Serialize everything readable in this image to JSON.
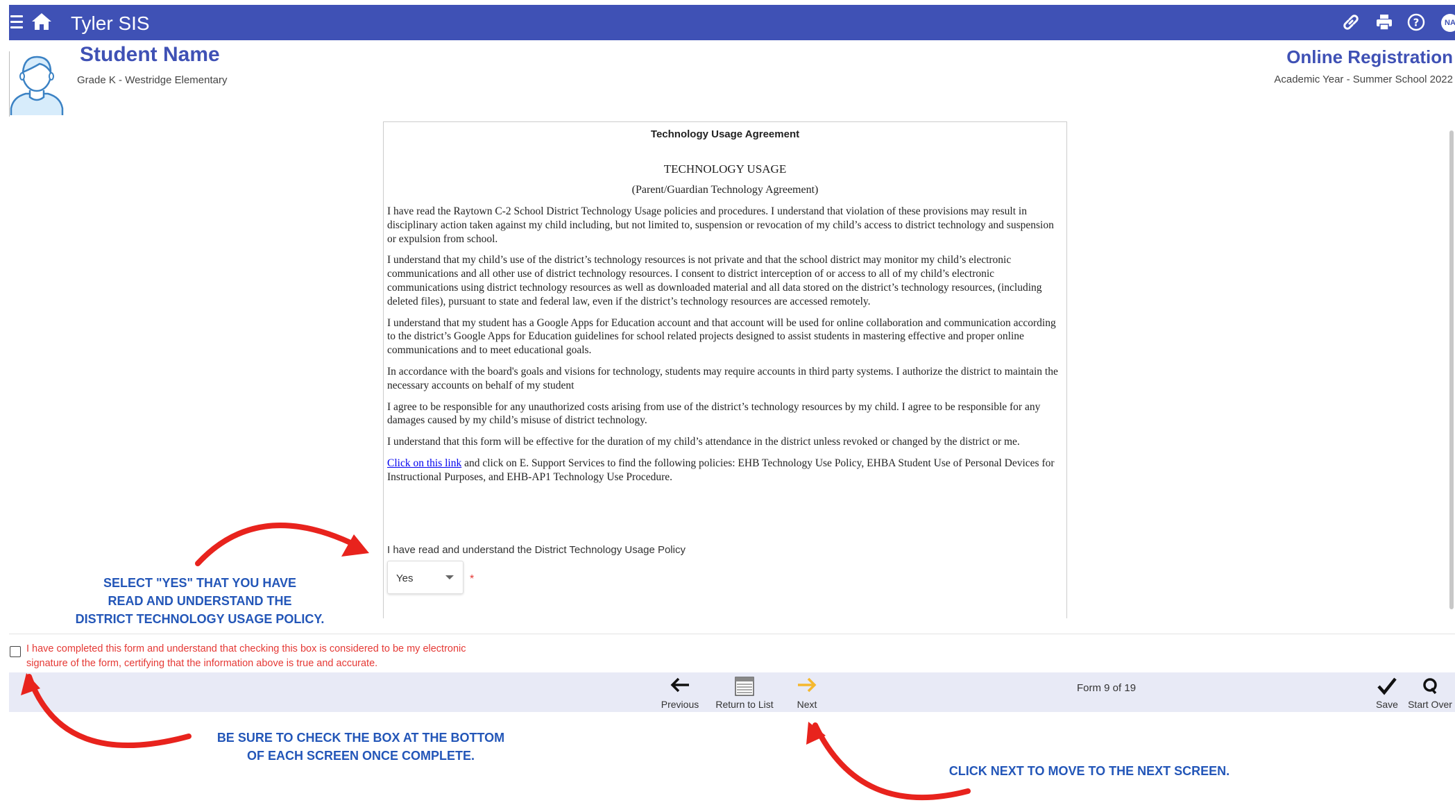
{
  "app": {
    "title": "Tyler SIS",
    "user_initials": "NA",
    "accent_color": "#3f51b5",
    "icons": [
      "menu-icon",
      "home-icon",
      "link-icon",
      "print-icon",
      "help-icon"
    ]
  },
  "student": {
    "name": "Student Name",
    "subtitle": "Grade K - Westridge Elementary"
  },
  "registration": {
    "title": "Online Registration",
    "subtitle": "Academic Year - Summer School 2022"
  },
  "document": {
    "header": "Technology Usage Agreement",
    "title": "TECHNOLOGY USAGE",
    "subtitle": "(Parent/Guardian Technology Agreement)",
    "paragraphs": [
      " I have read the Raytown C-2 School District Technology Usage policies and procedures.  I understand that violation of these provisions may result in disciplinary action taken against my child including, but not limited to, suspension or revocation of my child’s access to district technology and suspension or expulsion from school.",
      "I understand that my child’s use of the district’s technology resources is not private and that the school district may monitor my child’s electronic communications and all other use of district technology resources. I consent to district interception of or access to all of my child’s electronic communications using district technology resources as well as downloaded material and all data stored on the district’s technology resources, (including deleted files), pursuant to state and federal law, even if the district’s technology resources are accessed remotely.",
      "I understand that my student has a Google Apps for Education account and that account will be used for online collaboration and communication according to the district’s Google Apps for Education guidelines for school related projects designed to assist students in mastering effective and proper online communications and to meet educational goals.",
      "In accordance with the board's goals and visions for technology, students may require accounts in third party systems. I authorize the district to maintain the necessary accounts on behalf of my student",
      "I agree to be responsible for any unauthorized costs arising from use of the district’s technology resources by my child. I agree to be responsible for any damages caused by my child’s misuse of district technology.",
      "I understand that this form will be effective for the duration of my child’s attendance in the district unless revoked or changed by the district or me."
    ],
    "link_text": " Click on this link",
    "link_paragraph_rest": " and click on E. Support Services to find the following policies: EHB Technology Use Policy, EHBA Student Use of Personal Devices for Instructional Purposes, and EHB-AP1 Technology Use Procedure.",
    "question": "I have read and understand the District Technology Usage Policy",
    "answer": "Yes",
    "required_marker": "*"
  },
  "signature": {
    "checked": false,
    "text": "I have completed this form and understand that checking this box is considered to be my electronic signature of the form, certifying that the information above is true and accurate."
  },
  "footer": {
    "previous": "Previous",
    "return": "Return to List",
    "next": "Next",
    "form_count": "Form 9 of 19",
    "save": "Save",
    "start_over": "Start Over"
  },
  "annotations": {
    "select_yes": [
      "SELECT \"YES\" THAT YOU HAVE",
      "READ AND UNDERSTAND THE",
      "DISTRICT TECHNOLOGY USAGE POLICY."
    ],
    "check_box": [
      "BE SURE TO CHECK THE BOX AT THE BOTTOM",
      "OF EACH SCREEN ONCE COMPLETE."
    ],
    "click_next": "CLICK NEXT TO MOVE TO THE NEXT SCREEN.",
    "text_color": "#2356b8",
    "arrow_color": "#e8231d"
  }
}
